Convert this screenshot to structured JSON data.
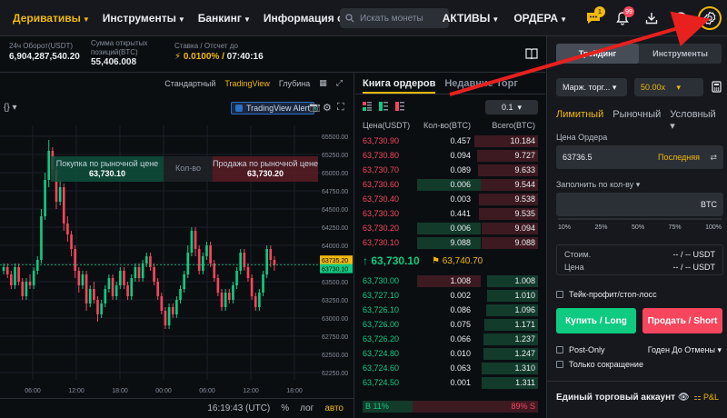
{
  "nav": {
    "items": [
      "Деривативы",
      "Инструменты",
      "Банкинг",
      "Информация о деривативах"
    ],
    "search_placeholder": "Искать монеты",
    "assets": "АКТИВЫ",
    "orders": "ОРДЕРА",
    "chat_badge": "1",
    "notif_badge": "99"
  },
  "ticker": {
    "turnover_label": "24ч Оборот(USDT)",
    "turnover_value": "6,904,287,540.20",
    "oi_label_1": "Сумма открытых",
    "oi_label_2": "позиций(BTC)",
    "oi_value": "55,406.008",
    "funding_label": "Ставка / Отсчет до",
    "funding_rate": "0.0100%",
    "countdown": "07:40:16"
  },
  "chart_toolbar": {
    "standard": "Стандартный",
    "tradingview": "TradingView",
    "depth": "Глубина",
    "tv_alert": "TradingView Alert",
    "interval_icon": "{}"
  },
  "order_overlay": {
    "buy_label": "Покупка по рыночной цене",
    "buy_price": "63,730.10",
    "qty_label": "Кол-во",
    "sell_label": "Продажа по рыночной цене",
    "sell_price": "63,730.20"
  },
  "chart_data": {
    "type": "candlestick",
    "title": "",
    "x_tick_labels": [
      "06:00",
      "12:00",
      "18:00",
      "00:00",
      "06:00",
      "12:00",
      "18:00"
    ],
    "y_tick_labels": [
      "65500.00",
      "65250.00",
      "65000.00",
      "64750.00",
      "64500.00",
      "64250.00",
      "64000.00",
      "63750.00",
      "63500.00",
      "63250.00",
      "63000.00",
      "62750.00",
      "62500.00",
      "62250.00"
    ],
    "ylim": [
      62150,
      65650
    ],
    "price_tags": [
      "63735.20",
      "63730.10"
    ],
    "colors": {
      "up": "#0ecb81",
      "down": "#f6465d"
    },
    "candles": [
      [
        63650,
        63700,
        63600,
        63750
      ],
      [
        63700,
        63600,
        63550,
        63750
      ],
      [
        63600,
        63450,
        63400,
        63650
      ],
      [
        63450,
        63700,
        63400,
        63750
      ],
      [
        63700,
        63500,
        63450,
        63750
      ],
      [
        63500,
        63300,
        63250,
        63550
      ],
      [
        63300,
        63500,
        63250,
        63550
      ],
      [
        63500,
        63450,
        63400,
        63600
      ],
      [
        63450,
        63650,
        63400,
        63700
      ],
      [
        63650,
        63800,
        63600,
        63850
      ],
      [
        63800,
        64400,
        63750,
        64500
      ],
      [
        64400,
        64900,
        64350,
        65000
      ],
      [
        64900,
        65300,
        64800,
        65450
      ],
      [
        65300,
        65050,
        64950,
        65350
      ],
      [
        65050,
        64600,
        64500,
        65100
      ],
      [
        64600,
        64800,
        64550,
        64900
      ],
      [
        64800,
        64300,
        64200,
        64850
      ],
      [
        64300,
        64150,
        64050,
        64400
      ],
      [
        64150,
        63950,
        63850,
        64200
      ],
      [
        63950,
        63650,
        63550,
        64000
      ],
      [
        63650,
        63450,
        63350,
        63700
      ],
      [
        63450,
        63600,
        63400,
        63650
      ],
      [
        63600,
        63200,
        63100,
        63650
      ],
      [
        63200,
        63400,
        63150,
        63450
      ],
      [
        63400,
        63250,
        63200,
        63500
      ],
      [
        63250,
        63050,
        62950,
        63300
      ],
      [
        63050,
        63200,
        63000,
        63250
      ],
      [
        63200,
        63400,
        63150,
        63450
      ],
      [
        63400,
        63550,
        63350,
        63600
      ],
      [
        63550,
        63300,
        63250,
        63600
      ],
      [
        63300,
        63450,
        63250,
        63500
      ],
      [
        63450,
        63650,
        63400,
        63700
      ],
      [
        63650,
        63450,
        63400,
        63700
      ],
      [
        63450,
        63300,
        63250,
        63500
      ],
      [
        63300,
        63550,
        63250,
        63600
      ],
      [
        63550,
        63700,
        63500,
        63750
      ],
      [
        63700,
        63550,
        63500,
        63750
      ],
      [
        63550,
        63750,
        63500,
        63800
      ],
      [
        63750,
        63850,
        63700,
        63900
      ],
      [
        63850,
        63700,
        63650,
        63900
      ],
      [
        63700,
        63500,
        63450,
        63750
      ],
      [
        63500,
        63300,
        63250,
        63550
      ],
      [
        63300,
        63100,
        63050,
        63350
      ],
      [
        63100,
        62900,
        62850,
        63150
      ],
      [
        62900,
        63150,
        62850,
        63200
      ],
      [
        63150,
        63050,
        63000,
        63200
      ],
      [
        63050,
        63250,
        63000,
        63300
      ],
      [
        63250,
        63400,
        63200,
        63450
      ],
      [
        63400,
        63600,
        63350,
        63650
      ],
      [
        63600,
        63900,
        63550,
        64000
      ],
      [
        63900,
        64200,
        63850,
        64250
      ],
      [
        64200,
        63950,
        63850,
        64250
      ],
      [
        63950,
        63650,
        63600,
        64000
      ],
      [
        63650,
        63850,
        63600,
        63900
      ],
      [
        63850,
        64000,
        63800,
        64050
      ],
      [
        64000,
        63750,
        63700,
        64050
      ],
      [
        63750,
        63550,
        63500,
        63800
      ],
      [
        63550,
        63350,
        63300,
        63600
      ],
      [
        63350,
        63150,
        63100,
        63400
      ],
      [
        63150,
        63350,
        63100,
        63400
      ],
      [
        63350,
        63250,
        63200,
        63400
      ],
      [
        63250,
        63450,
        63200,
        63500
      ],
      [
        63450,
        63650,
        63400,
        63700
      ],
      [
        63650,
        63900,
        63600,
        63950
      ],
      [
        63900,
        63700,
        63650,
        63950
      ],
      [
        63700,
        63550,
        63500,
        63750
      ],
      [
        63550,
        63300,
        63250,
        63600
      ],
      [
        63300,
        63150,
        63100,
        63350
      ],
      [
        63150,
        63350,
        63100,
        63400
      ],
      [
        63350,
        63600,
        63300,
        63650
      ],
      [
        63600,
        63950,
        63550,
        64000
      ],
      [
        63950,
        63800,
        63700,
        64000
      ],
      [
        63800,
        63730,
        63650,
        63850
      ]
    ]
  },
  "chart_footer": {
    "time": "16:19:43 (UTC)",
    "percent": "%",
    "log": "лог",
    "auto": "авто"
  },
  "orderbook": {
    "tab_book": "Книга ордеров",
    "tab_trades": "Недавние Торг",
    "precision": "0.1",
    "col_price": "Цена(USDT)",
    "col_qty": "Кол-во(BTC)",
    "col_total": "Всего(BTC)",
    "asks": [
      {
        "p": "63,730.90",
        "a": "0.457",
        "t": "10.184",
        "d": 1.0,
        "g": 0
      },
      {
        "p": "63,730.80",
        "a": "0.094",
        "t": "9.727",
        "d": 0.95,
        "g": 0
      },
      {
        "p": "63,730.70",
        "a": "0.089",
        "t": "9.633",
        "d": 0.94,
        "g": 0
      },
      {
        "p": "63,730.60",
        "a": "0.006",
        "t": "9.544",
        "d": 0.93,
        "g": 1
      },
      {
        "p": "63,730.40",
        "a": "0.003",
        "t": "9.538",
        "d": 0.93,
        "g": 0
      },
      {
        "p": "63,730.30",
        "a": "0.441",
        "t": "9.535",
        "d": 0.93,
        "g": 0
      },
      {
        "p": "63,730.20",
        "a": "0.006",
        "t": "9.094",
        "d": 0.89,
        "g": 1
      },
      {
        "p": "63,730.10",
        "a": "9.088",
        "t": "9.088",
        "d": 0.89,
        "g": 1
      }
    ],
    "mid_price": "63,730.10",
    "mark_price": "63,740.70",
    "bids": [
      {
        "p": "63,730.00",
        "a": "1.008",
        "t": "1.008",
        "d": 0.8,
        "g": 1
      },
      {
        "p": "63,727.10",
        "a": "0.002",
        "t": "1.010",
        "d": 0.8,
        "g": 0
      },
      {
        "p": "63,726.10",
        "a": "0.086",
        "t": "1.096",
        "d": 0.82,
        "g": 0
      },
      {
        "p": "63,726.00",
        "a": "0.075",
        "t": "1.171",
        "d": 0.84,
        "g": 0
      },
      {
        "p": "63,726.20",
        "a": "0.066",
        "t": "1.237",
        "d": 0.86,
        "g": 0
      },
      {
        "p": "63,724.80",
        "a": "0.010",
        "t": "1.247",
        "d": 0.86,
        "g": 0
      },
      {
        "p": "63,724.60",
        "a": "0.063",
        "t": "1.310",
        "d": 0.88,
        "g": 0
      },
      {
        "p": "63,724.50",
        "a": "0.001",
        "t": "1.311",
        "d": 0.88,
        "g": 0
      }
    ],
    "buy_ratio": "11%",
    "sell_ratio": "89%",
    "buy_ratio_letter": "B",
    "sell_ratio_letter": "S"
  },
  "trade": {
    "tab_trading": "Трейдинг",
    "tab_tools": "Инструменты",
    "margin_mode": "Марж. торг...",
    "leverage": "50.00x",
    "order_types": [
      "Лимитный",
      "Рыночный",
      "Условный"
    ],
    "price_label": "Цена Ордера",
    "price_value": "63736.5",
    "price_suffix": "Последняя",
    "qty_label": "Заполнить по кол-ву",
    "qty_unit": "BTC",
    "pcts": [
      "10%",
      "25%",
      "50%",
      "75%",
      "100%"
    ],
    "cost_label": "Стоим.",
    "cost_value": "-- / -- USDT",
    "price2_label": "Цена",
    "price2_value": "-- / -- USDT",
    "tpsl": "Тейк-профит/стоп-лосс",
    "buy_button": "Купить / Long",
    "sell_button": "Продать / Short",
    "post_only": "Post-Only",
    "reduce_only": "Только сокращение",
    "gtc": "Годен До Отмены",
    "account_title": "Единый торговый аккаунт",
    "pnl": "P&L"
  }
}
